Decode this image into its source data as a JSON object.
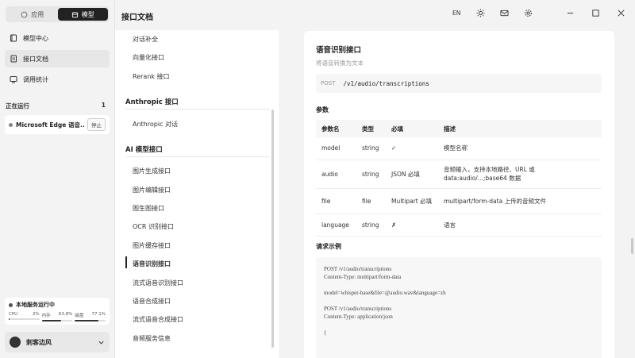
{
  "sidebar": {
    "tabs": [
      {
        "label": "应用",
        "icon": "chat-icon"
      },
      {
        "label": "模型",
        "icon": "cube-icon"
      }
    ],
    "nav": [
      {
        "label": "模型中心",
        "icon": "book-icon"
      },
      {
        "label": "接口文档",
        "icon": "doc-icon"
      },
      {
        "label": "调用统计",
        "icon": "chart-icon"
      }
    ],
    "running_title": "正在运行",
    "running_count": "1",
    "running_item": "Microsoft Edge 语音...",
    "stop_label": "停止",
    "service_title": "本地服务运行中",
    "metrics": [
      {
        "name": "CPU",
        "value": "2%",
        "level": 0.02
      },
      {
        "name": "内存",
        "value": "63.8%",
        "level": 0.638
      },
      {
        "name": "磁盘",
        "value": "77.1%",
        "level": 0.771
      }
    ],
    "user_name": "刺客边风"
  },
  "header": {
    "title": "接口文档",
    "lang": "EN"
  },
  "docnav": {
    "top_items": [
      "对话补全",
      "向量化接口",
      "Rerank 接口"
    ],
    "groups": [
      {
        "title": "Anthropic 接口",
        "items": [
          "Anthropic 对话"
        ]
      },
      {
        "title": "AI 模型接口",
        "items": [
          "图片生成接口",
          "图片编辑接口",
          "图生图接口",
          "OCR 识别接口",
          "图片缓存接口",
          "语音识别接口",
          "流式语音识别接口",
          "语音合成接口",
          "流式语音合成接口",
          "音频服务信息"
        ]
      }
    ],
    "active": "语音识别接口"
  },
  "main": {
    "title": "语音识别接口",
    "subtitle": "将语音转换为文本",
    "method": "POST",
    "path": "/v1/audio/transcriptions",
    "params_title": "参数",
    "table": {
      "headers": [
        "参数名",
        "类型",
        "必填",
        "描述"
      ],
      "rows": [
        [
          "model",
          "string",
          "✓",
          "模型名称"
        ],
        [
          "audio",
          "string",
          "JSON 必填",
          "音频输入，支持本地路径、URL 或 data:audio/...;base64 数据"
        ],
        [
          "file",
          "file",
          "Multipart 必填",
          "multipart/form-data 上传的音频文件"
        ],
        [
          "language",
          "string",
          "✗",
          "语言"
        ]
      ]
    },
    "example_title": "请求示例",
    "code": "POST /v1/audio/transcriptions\nContent-Type: multipart/form-data\n\nmodel=whisper-base&file=@audio.wav&language=zh\n\nPOST /v1/audio/transcriptions\nContent-Type: application/json\n\n{"
  }
}
